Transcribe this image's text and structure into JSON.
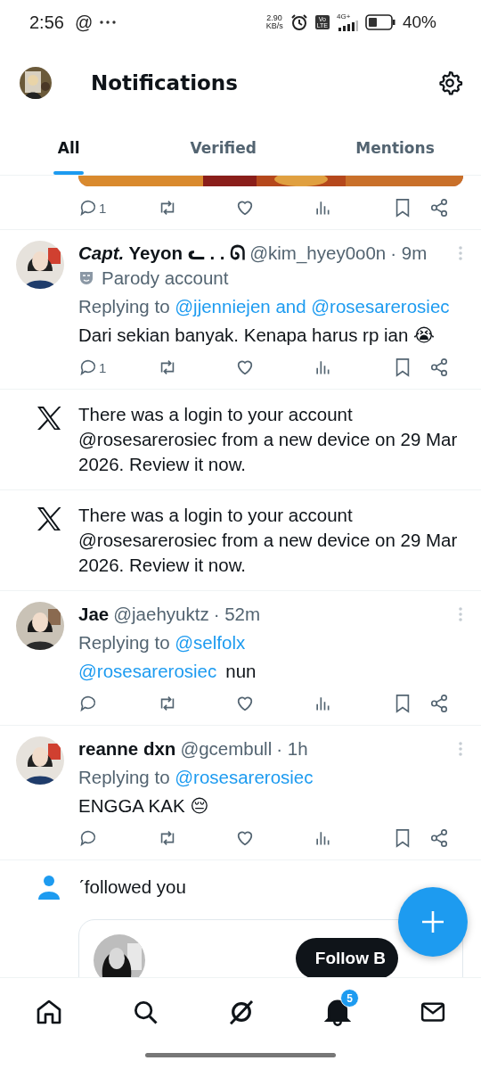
{
  "status_bar": {
    "time": "2:56",
    "at_sign": "@",
    "net_speed": "2.90",
    "net_unit": "KB/s",
    "volte": [
      "Vo",
      "LTE"
    ],
    "network": "4G+",
    "battery": "40%"
  },
  "header": {
    "title": "Notifications"
  },
  "tabs": [
    {
      "label": "All",
      "selected": true
    },
    {
      "label": "Verified",
      "selected": false
    },
    {
      "label": "Mentions",
      "selected": false
    }
  ],
  "feed": [
    {
      "kind": "tweet_tail",
      "reply_count": "1"
    },
    {
      "kind": "tweet",
      "name": "*Capt.* Yeyon ᓚ . . ᘏ",
      "handle": "@kim_hyey0o0n",
      "time": "· 9m",
      "parody": "Parody account",
      "replying_label": "Replying to",
      "replying_to": "@jjenniejen and @rosesarerosiec",
      "text": "Dari sekian banyak. Kenapa harus rp ian 😭",
      "reply_count": "1"
    },
    {
      "kind": "system",
      "text": "There was a login to your account @rosesarerosiec from a new device on 29 Mar 2026. Review it now."
    },
    {
      "kind": "system",
      "text": "There was a login to your account @rosesarerosiec from a new device on 29 Mar 2026. Review it now."
    },
    {
      "kind": "tweet",
      "name": "Jae",
      "handle": "@jaehyuktz",
      "time": "· 52m",
      "replying_label": "Replying to",
      "replying_to": "@selfolx",
      "mention": "@rosesarerosiec",
      "text": "nun"
    },
    {
      "kind": "tweet",
      "name": "reanne dxn",
      "handle": "@gcembull",
      "time": "· 1h",
      "replying_label": "Replying to",
      "replying_to": "@rosesarerosiec",
      "text": "ENGGA KAK 😔"
    },
    {
      "kind": "follow",
      "text": "ˊfollowed you",
      "button": "Follow B"
    }
  ],
  "nav": [
    {
      "kind": "home",
      "selected": false
    },
    {
      "kind": "search",
      "selected": false
    },
    {
      "kind": "grok",
      "selected": false
    },
    {
      "kind": "bell",
      "selected": true,
      "badge": "5"
    },
    {
      "kind": "mail",
      "selected": false
    }
  ]
}
